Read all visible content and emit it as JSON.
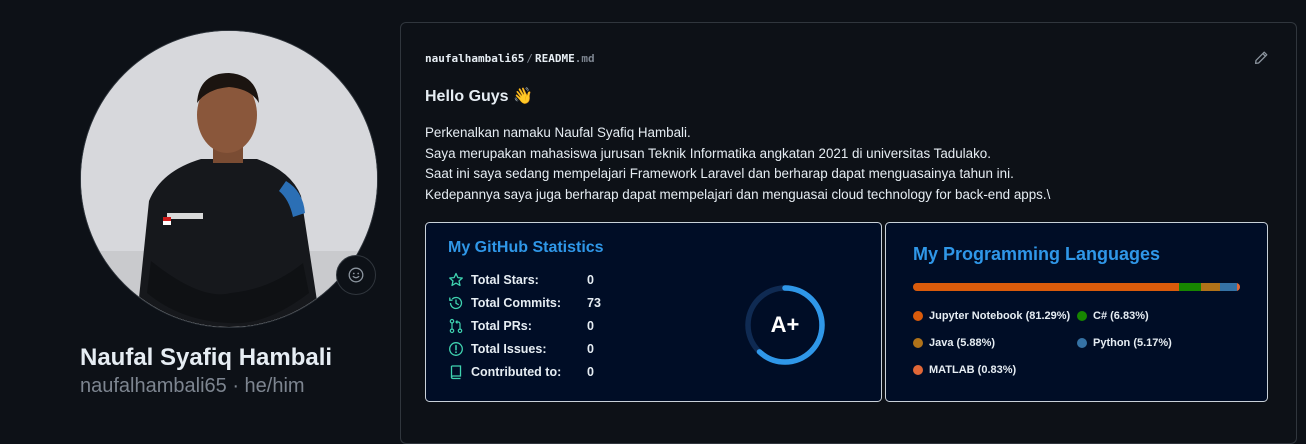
{
  "profile": {
    "name": "Naufal Syafiq Hambali",
    "subtitle": "naufalhambali65 · he/him"
  },
  "readme": {
    "user": "naufalhambali65",
    "separator": "/",
    "file_name": "README",
    "file_ext": ".md",
    "heading": "Hello Guys 👋",
    "paragraph": [
      "Perkenalkan namaku Naufal Syafiq Hambali.",
      "Saya merupakan mahasiswa jurusan Teknik Informatika angkatan 2021 di universitas Tadulako.",
      "Saat ini saya sedang mempelajari Framework Laravel dan berharap dapat menguasainya tahun ini.",
      "Kedepannya saya juga berharap dapat mempelajari dan menguasai cloud technology for back-end apps.\\"
    ]
  },
  "stats": {
    "title": "My GitHub Statistics",
    "rank": "A+",
    "rank_progress": 0.62,
    "rows": [
      {
        "label": "Total Stars:",
        "value": "0",
        "icon": "star-icon"
      },
      {
        "label": "Total Commits:",
        "value": "73",
        "icon": "history-icon"
      },
      {
        "label": "Total PRs:",
        "value": "0",
        "icon": "pull-request-icon"
      },
      {
        "label": "Total Issues:",
        "value": "0",
        "icon": "issue-icon"
      },
      {
        "label": "Contributed to:",
        "value": "0",
        "icon": "repo-icon"
      }
    ],
    "accent": "#2f97e8",
    "icon_color": "#3fd3b0"
  },
  "languages": {
    "title": "My Programming Languages",
    "items": [
      {
        "label": "Jupyter Notebook (81.29%)",
        "percent": 81.29,
        "color": "#da5b0b"
      },
      {
        "label": "C# (6.83%)",
        "percent": 6.83,
        "color": "#178600"
      },
      {
        "label": "Java (5.88%)",
        "percent": 5.88,
        "color": "#b07219"
      },
      {
        "label": "Python (5.17%)",
        "percent": 5.17,
        "color": "#3572a5"
      },
      {
        "label": "MATLAB (0.83%)",
        "percent": 0.83,
        "color": "#e16737"
      }
    ]
  }
}
